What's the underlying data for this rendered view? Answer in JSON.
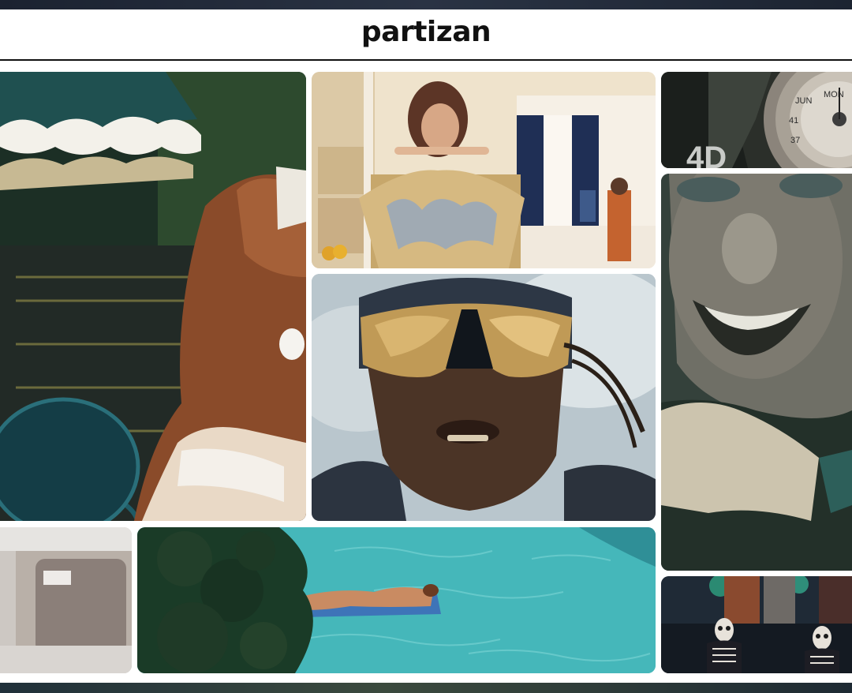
{
  "header": {
    "logo_text": "partizan"
  },
  "colors": {
    "background": "#ffffff",
    "header_rule": "#111111",
    "logo": "#111111"
  },
  "gallery": {
    "tiles": [
      {
        "name": "girl-by-pool-umbrella"
      },
      {
        "name": "woman-in-kitchen"
      },
      {
        "name": "watch-closeup"
      },
      {
        "name": "man-with-reflective-goggles"
      },
      {
        "name": "smiling-man-closeup"
      },
      {
        "name": "blurred-frame"
      },
      {
        "name": "woman-on-pool-float"
      },
      {
        "name": "skeleton-masks-stage"
      }
    ]
  }
}
